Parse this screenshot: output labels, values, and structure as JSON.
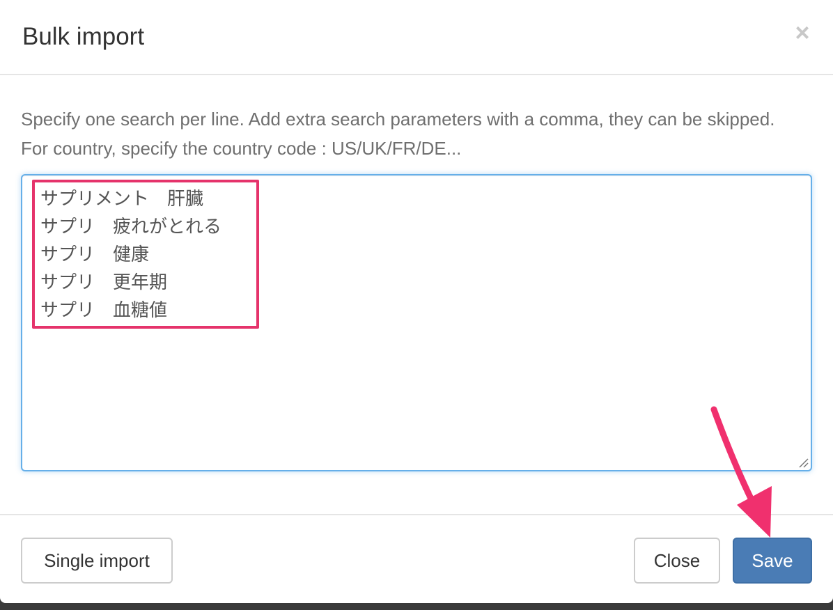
{
  "modal": {
    "title": "Bulk import",
    "close_glyph": "×",
    "help_text": "Specify one search per line. Add extra search parameters with a comma, they can be skipped. For country, specify the country code : US/UK/FR/DE...",
    "searches": [
      "サプリメント　肝臓",
      "サプリ　疲れがとれる",
      "サプリ　健康",
      "サプリ　更年期",
      "サプリ　血糖値"
    ]
  },
  "footer": {
    "single_import_label": "Single import",
    "close_label": "Close",
    "save_label": "Save"
  },
  "annotation": {
    "color": "#e5336b"
  },
  "colors": {
    "primary": "#4a7cb5",
    "focus_border": "#66afe9"
  },
  "icons": {
    "close": "close-icon",
    "resize": "resize-grip-icon",
    "arrow": "pointer-arrow-icon"
  }
}
